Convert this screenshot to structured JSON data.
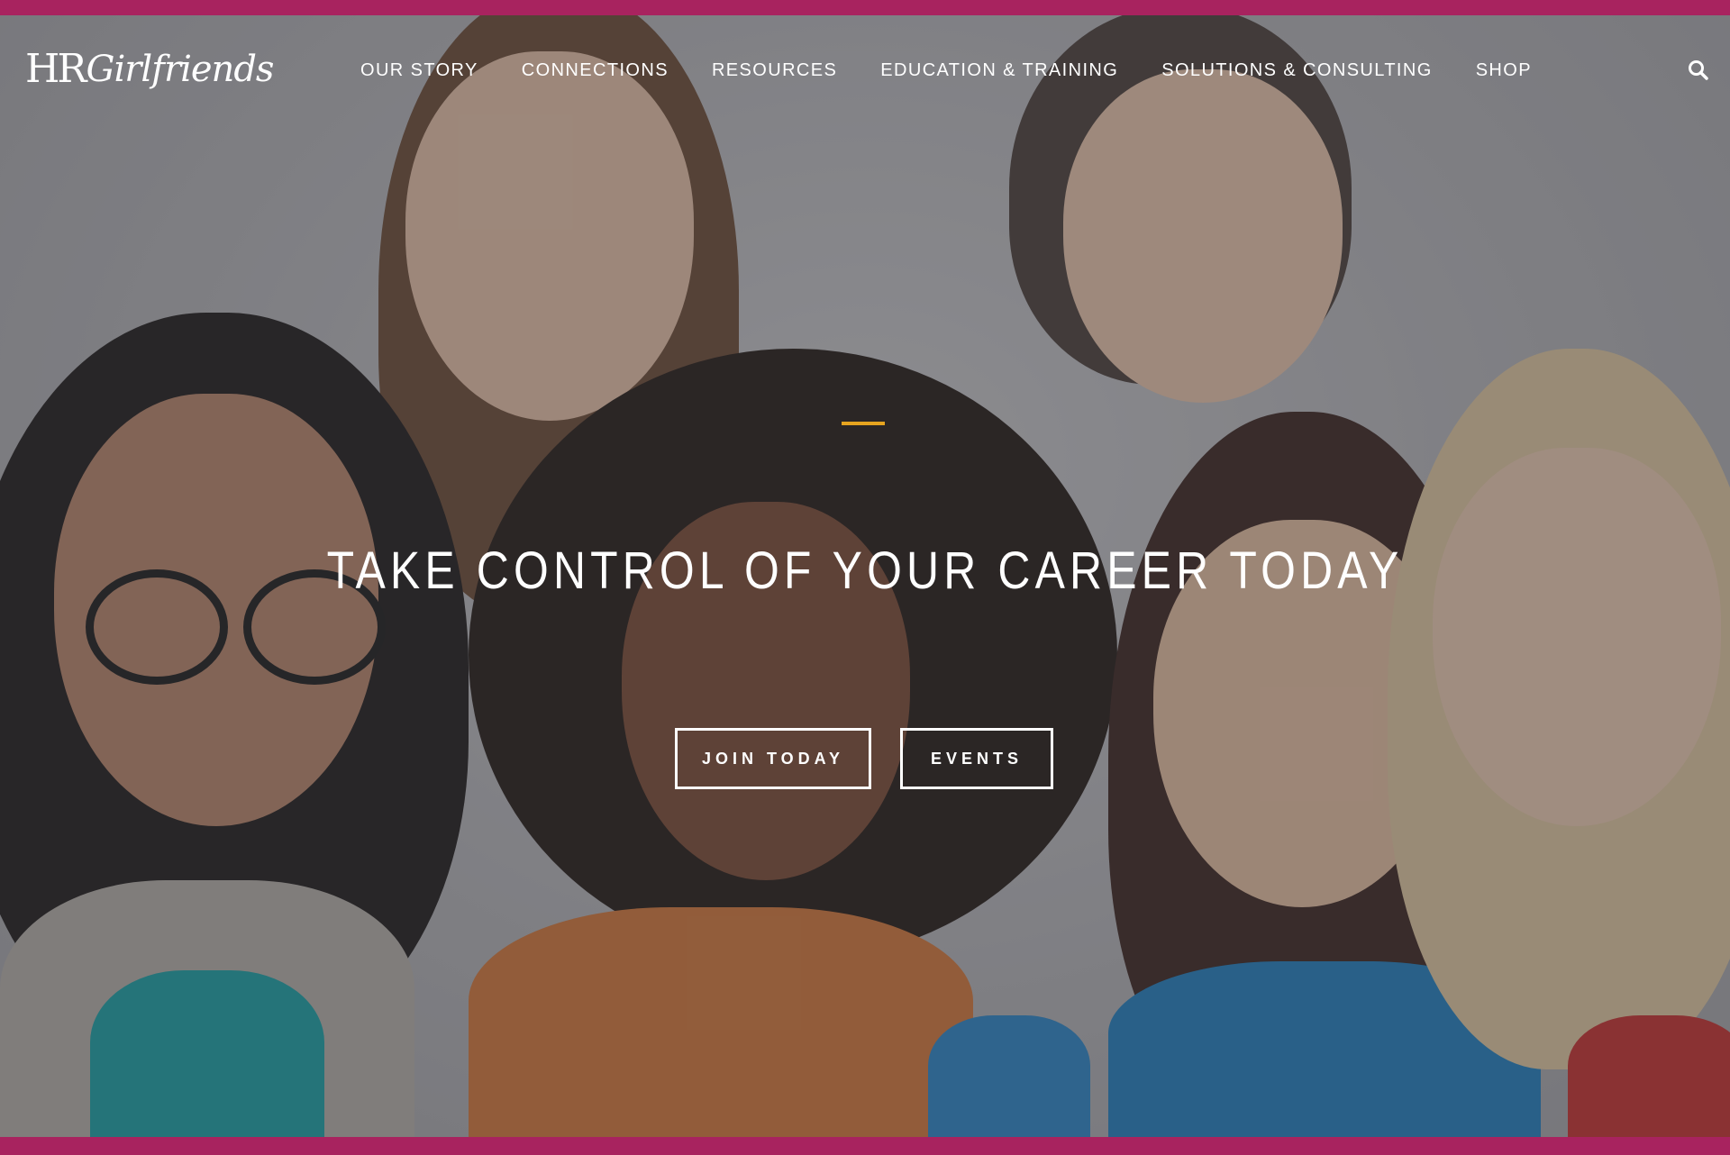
{
  "brand": {
    "logo_hr": "HR",
    "logo_girlfriends": "Girlfriends",
    "accent_color": "#a8235f",
    "highlight_color": "#e6a41f"
  },
  "nav": {
    "items": [
      {
        "label": "OUR STORY"
      },
      {
        "label": "CONNECTIONS"
      },
      {
        "label": "RESOURCES"
      },
      {
        "label": "EDUCATION & TRAINING"
      },
      {
        "label": "SOLUTIONS & CONSULTING"
      },
      {
        "label": "SHOP"
      }
    ],
    "search_icon": "search-icon"
  },
  "hero": {
    "headline": "TAKE CONTROL OF YOUR CAREER TODAY",
    "buttons": {
      "join": "JOIN TODAY",
      "events": "EVENTS"
    }
  }
}
